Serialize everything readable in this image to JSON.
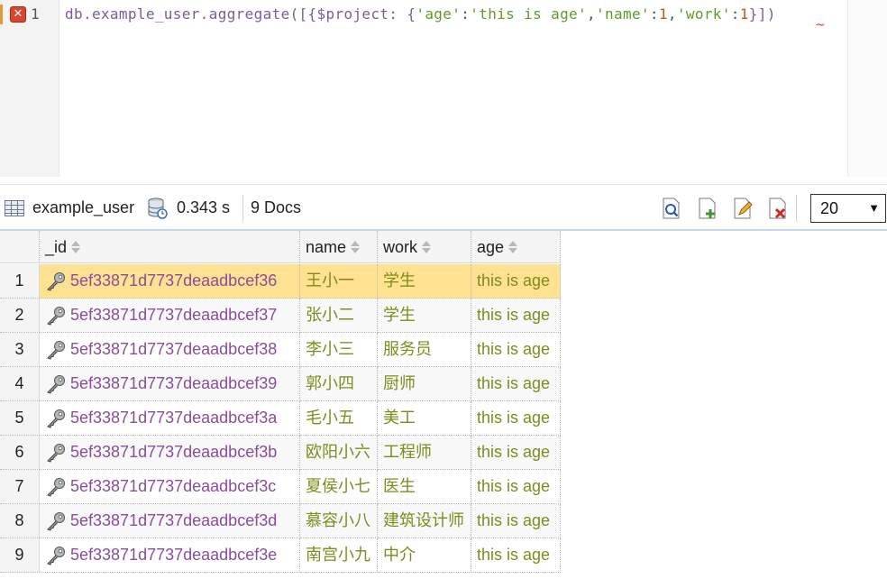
{
  "editor": {
    "line_number": "1",
    "error_icon_glyph": "✕",
    "code": {
      "p1": "db.example_user.aggregate([{$project: {",
      "s1": "'age'",
      "p2": ":",
      "s2": "'this is age'",
      "p3": ",",
      "s3": "'name'",
      "p4": ":",
      "n1": "1",
      "p5": ",",
      "s4": "'work'",
      "p6": ":",
      "n2": "1",
      "p7": "}])"
    },
    "error_squiggle": "~"
  },
  "toolbar": {
    "collection": "example_user",
    "time": "0.343 s",
    "docs": "9 Docs",
    "page_size": "20",
    "icons": [
      "grid-icon",
      "database-icon",
      "view-document-icon",
      "add-document-icon",
      "edit-document-icon",
      "delete-document-icon"
    ]
  },
  "table": {
    "columns": [
      "_id",
      "name",
      "work",
      "age"
    ],
    "rows": [
      {
        "n": "1",
        "id": "5ef33871d7737deaadbcef36",
        "name": "王小一",
        "work": "学生",
        "age": "this is age"
      },
      {
        "n": "2",
        "id": "5ef33871d7737deaadbcef37",
        "name": "张小二",
        "work": "学生",
        "age": "this is age"
      },
      {
        "n": "3",
        "id": "5ef33871d7737deaadbcef38",
        "name": "李小三",
        "work": "服务员",
        "age": "this is age"
      },
      {
        "n": "4",
        "id": "5ef33871d7737deaadbcef39",
        "name": "郭小四",
        "work": "厨师",
        "age": "this is age"
      },
      {
        "n": "5",
        "id": "5ef33871d7737deaadbcef3a",
        "name": "毛小五",
        "work": "美工",
        "age": "this is age"
      },
      {
        "n": "6",
        "id": "5ef33871d7737deaadbcef3b",
        "name": "欧阳小六",
        "work": "工程师",
        "age": "this is age"
      },
      {
        "n": "7",
        "id": "5ef33871d7737deaadbcef3c",
        "name": "夏侯小七",
        "work": "医生",
        "age": "this is age"
      },
      {
        "n": "8",
        "id": "5ef33871d7737deaadbcef3d",
        "name": "慕容小八",
        "work": "建筑设计师",
        "age": "this is age"
      },
      {
        "n": "9",
        "id": "5ef33871d7737deaadbcef3e",
        "name": "南宫小九",
        "work": "中介",
        "age": "this is age"
      }
    ],
    "selected_row": "1"
  },
  "colors": {
    "selected_row": "#ffe291",
    "id_text": "#8a4d9a",
    "value_text": "#7f8b1c"
  }
}
